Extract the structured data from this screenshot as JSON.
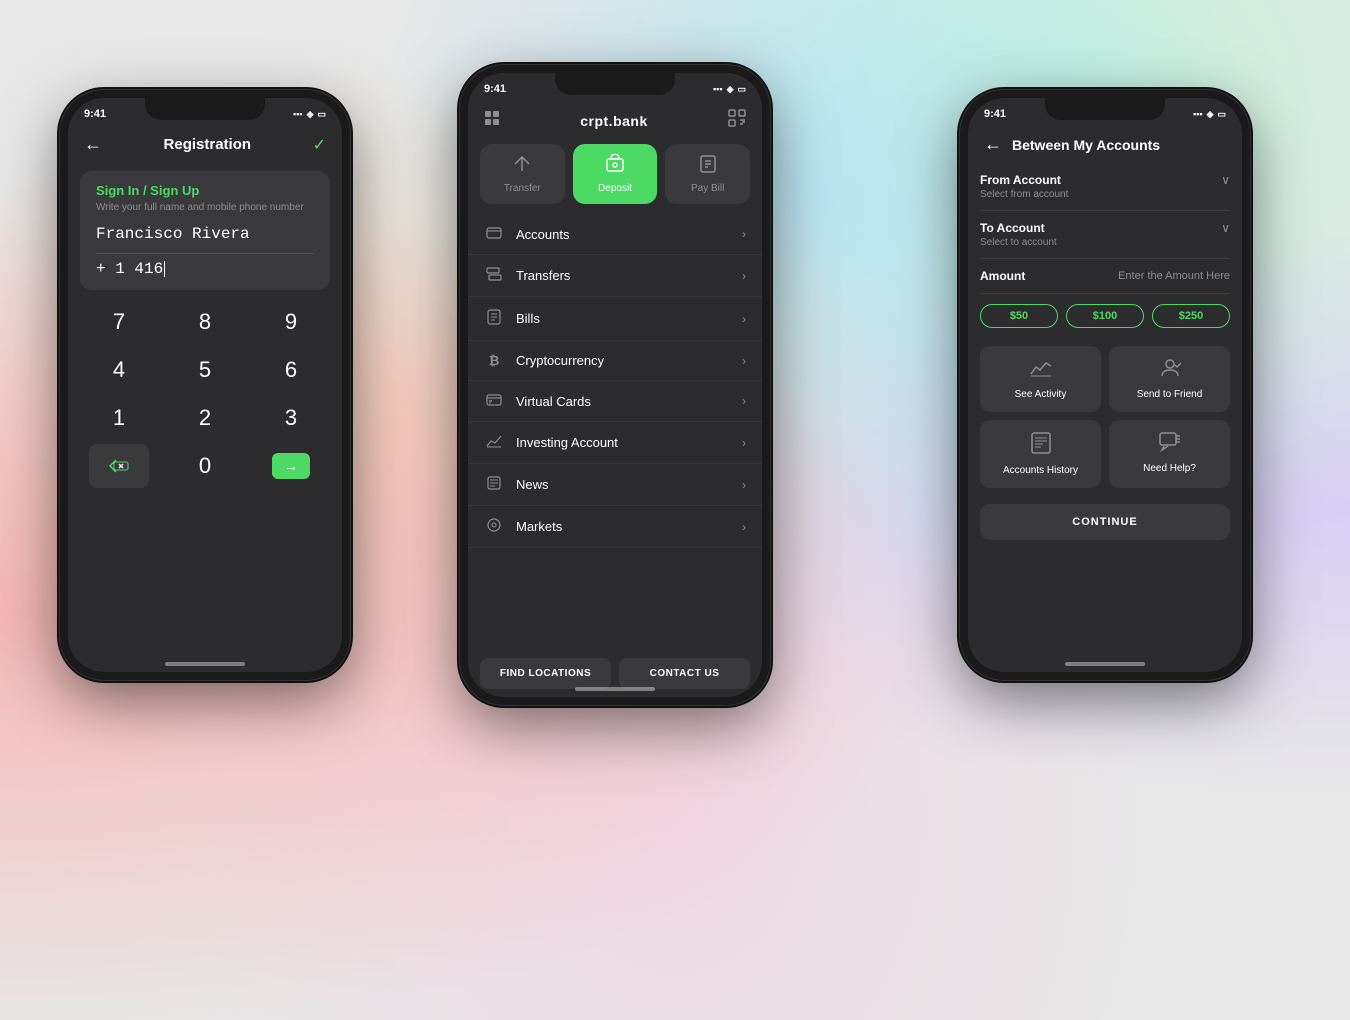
{
  "background": {
    "colors": [
      "#f5c0c0",
      "#f0d0a0",
      "#a0d8ef",
      "#a0efcc",
      "#c8b4f0",
      "#f5a0cc"
    ]
  },
  "phone1": {
    "statusBar": {
      "time": "9:41",
      "signal": "●●●",
      "wifi": "▲",
      "battery": "▬"
    },
    "header": {
      "backLabel": "←",
      "title": "Registration",
      "checkLabel": "✓"
    },
    "card": {
      "title": "Sign In / Sign Up",
      "subtitle": "Write your full name and mobile phone number",
      "name": "Francisco Rivera",
      "phone": "+ 1  416"
    },
    "numpad": {
      "rows": [
        [
          "7",
          "8",
          "9"
        ],
        [
          "4",
          "5",
          "6"
        ],
        [
          "1",
          "2",
          "3"
        ],
        [
          "⌫",
          "0",
          "→"
        ]
      ]
    }
  },
  "phone2": {
    "statusBar": {
      "time": "9:41",
      "signal": "●●●",
      "wifi": "▲",
      "battery": "▬"
    },
    "header": {
      "gridIcon": "⊞",
      "logo": "crpt.bank",
      "scanIcon": "⊡"
    },
    "actions": [
      {
        "icon": "✈",
        "label": "Transfer",
        "active": false
      },
      {
        "icon": "💳",
        "label": "Deposit",
        "active": true
      },
      {
        "icon": "📄",
        "label": "Pay Bill",
        "active": false
      }
    ],
    "menuItems": [
      {
        "icon": "▭",
        "label": "Accounts"
      },
      {
        "icon": "⇄",
        "label": "Transfers"
      },
      {
        "icon": "☰",
        "label": "Bills"
      },
      {
        "icon": "₿",
        "label": "Cryptocurrency"
      },
      {
        "icon": "▭",
        "label": "Virtual Cards"
      },
      {
        "icon": "📊",
        "label": "Investing Account"
      },
      {
        "icon": "📰",
        "label": "News"
      },
      {
        "icon": "◎",
        "label": "Markets"
      }
    ],
    "footer": {
      "findLocations": "FIND LOCATIONS",
      "contactUs": "CONTACT US"
    }
  },
  "phone3": {
    "statusBar": {
      "time": "9:41",
      "signal": "●●●",
      "wifi": "▲",
      "battery": "▬"
    },
    "header": {
      "backLabel": "←",
      "title": "Between My Accounts"
    },
    "fromAccount": {
      "label": "From Account",
      "placeholder": "Select from account"
    },
    "toAccount": {
      "label": "To Account",
      "placeholder": "Select to account"
    },
    "amount": {
      "label": "Amount",
      "placeholder": "Enter the  Amount Here"
    },
    "quickAmounts": [
      "$50",
      "$100",
      "$250"
    ],
    "cards": [
      {
        "icon": "📈",
        "label": "See Activity"
      },
      {
        "icon": "🤝",
        "label": "Send to Friend"
      },
      {
        "icon": "🧾",
        "label": "Accounts History"
      },
      {
        "icon": "💬",
        "label": "Need Help?"
      }
    ],
    "continueLabel": "CONTINUE"
  }
}
